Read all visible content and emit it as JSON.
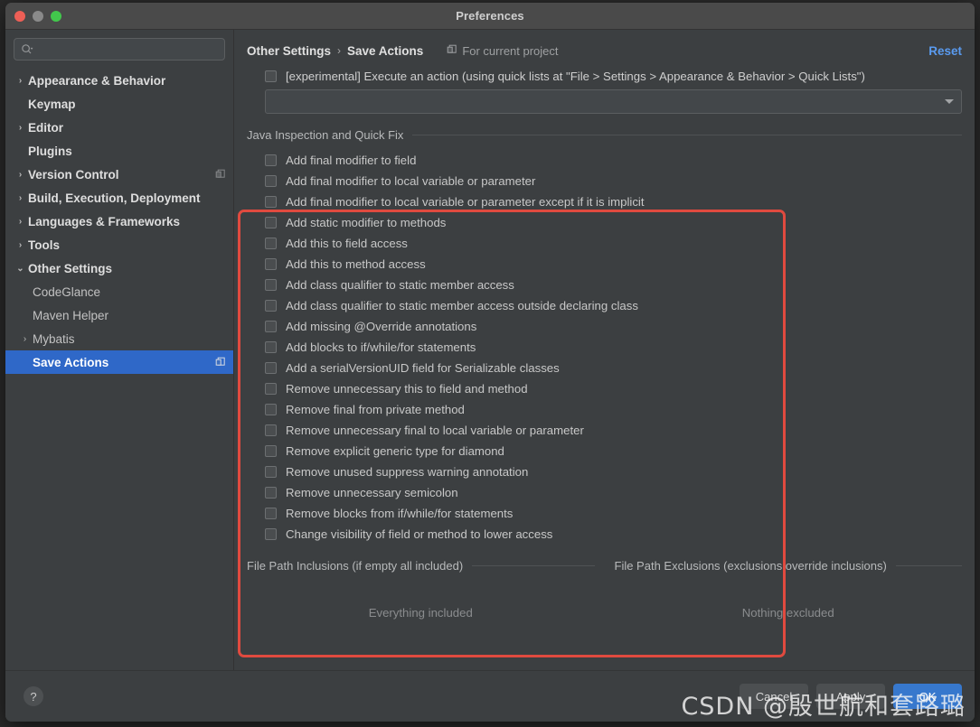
{
  "window": {
    "title": "Preferences",
    "traffic_lights": [
      "close",
      "minimize",
      "zoom"
    ]
  },
  "sidebar": {
    "search": {
      "placeholder": "",
      "value": "",
      "icon": "search-icon"
    },
    "items": [
      {
        "label": "Appearance & Behavior",
        "level": 0,
        "arrow": "›",
        "bold": true,
        "selected": false,
        "icon": null
      },
      {
        "label": "Keymap",
        "level": 0,
        "arrow": "",
        "bold": true,
        "selected": false,
        "icon": null
      },
      {
        "label": "Editor",
        "level": 0,
        "arrow": "›",
        "bold": true,
        "selected": false,
        "icon": null
      },
      {
        "label": "Plugins",
        "level": 0,
        "arrow": "",
        "bold": true,
        "selected": false,
        "icon": null
      },
      {
        "label": "Version Control",
        "level": 0,
        "arrow": "›",
        "bold": true,
        "selected": false,
        "icon": "project-scope-icon"
      },
      {
        "label": "Build, Execution, Deployment",
        "level": 0,
        "arrow": "›",
        "bold": true,
        "selected": false,
        "icon": null
      },
      {
        "label": "Languages & Frameworks",
        "level": 0,
        "arrow": "›",
        "bold": true,
        "selected": false,
        "icon": null
      },
      {
        "label": "Tools",
        "level": 0,
        "arrow": "›",
        "bold": true,
        "selected": false,
        "icon": null
      },
      {
        "label": "Other Settings",
        "level": 0,
        "arrow": "⌄",
        "bold": true,
        "selected": false,
        "icon": null
      },
      {
        "label": "CodeGlance",
        "level": 1,
        "arrow": "",
        "bold": false,
        "selected": false,
        "icon": null
      },
      {
        "label": "Maven Helper",
        "level": 1,
        "arrow": "",
        "bold": false,
        "selected": false,
        "icon": null
      },
      {
        "label": "Mybatis",
        "level": 1,
        "arrow": "›",
        "bold": false,
        "selected": false,
        "icon": null
      },
      {
        "label": "Save Actions",
        "level": 1,
        "arrow": "",
        "bold": true,
        "selected": true,
        "icon": "project-scope-icon"
      }
    ]
  },
  "panel": {
    "breadcrumb": {
      "parent": "Other Settings",
      "separator": "›",
      "current": "Save Actions"
    },
    "for_current_project": {
      "label": "For current project",
      "icon": "project-scope-icon"
    },
    "reset_label": "Reset",
    "experimental": {
      "checked": false,
      "label": "[experimental] Execute an action (using quick lists at \"File > Settings > Appearance & Behavior > Quick Lists\")"
    },
    "action_combo": {
      "value": "",
      "icon": "chevron-down-icon"
    },
    "group": {
      "title": "Java Inspection and Quick Fix",
      "options": [
        {
          "label": "Add final modifier to field",
          "checked": false
        },
        {
          "label": "Add final modifier to local variable or parameter",
          "checked": false
        },
        {
          "label": "Add final modifier to local variable or parameter except if it is implicit",
          "checked": false
        },
        {
          "label": "Add static modifier to methods",
          "checked": false
        },
        {
          "label": "Add this to field access",
          "checked": false
        },
        {
          "label": "Add this to method access",
          "checked": false
        },
        {
          "label": "Add class qualifier to static member access",
          "checked": false
        },
        {
          "label": "Add class qualifier to static member access outside declaring class",
          "checked": false
        },
        {
          "label": "Add missing @Override annotations",
          "checked": false
        },
        {
          "label": "Add blocks to if/while/for statements",
          "checked": false
        },
        {
          "label": "Add a serialVersionUID field for Serializable classes",
          "checked": false
        },
        {
          "label": "Remove unnecessary this to field and method",
          "checked": false
        },
        {
          "label": "Remove final from private method",
          "checked": false
        },
        {
          "label": "Remove unnecessary final to local variable or parameter",
          "checked": false
        },
        {
          "label": "Remove explicit generic type for diamond",
          "checked": false
        },
        {
          "label": "Remove unused suppress warning annotation",
          "checked": false
        },
        {
          "label": "Remove unnecessary semicolon",
          "checked": false
        },
        {
          "label": "Remove blocks from if/while/for statements",
          "checked": false
        },
        {
          "label": "Change visibility of field or method to lower access",
          "checked": false
        }
      ]
    },
    "paths": {
      "inclusions": {
        "title": "File Path Inclusions (if empty all included)",
        "empty_text": "Everything included"
      },
      "exclusions": {
        "title": "File Path Exclusions (exclusions override inclusions)",
        "empty_text": "Nothing excluded"
      }
    }
  },
  "footer": {
    "help_label": "?",
    "cancel_label": "Cancel",
    "apply_label": "Apply",
    "ok_label": "OK"
  },
  "watermark": {
    "text": "CSDN @殷世航和套路璐"
  },
  "colors": {
    "accent_selection": "#2f68c8",
    "link": "#5a9bf0",
    "highlight_box": "#e04a3f",
    "primary_button": "#3778cd",
    "window_bg": "#3c3f41"
  }
}
